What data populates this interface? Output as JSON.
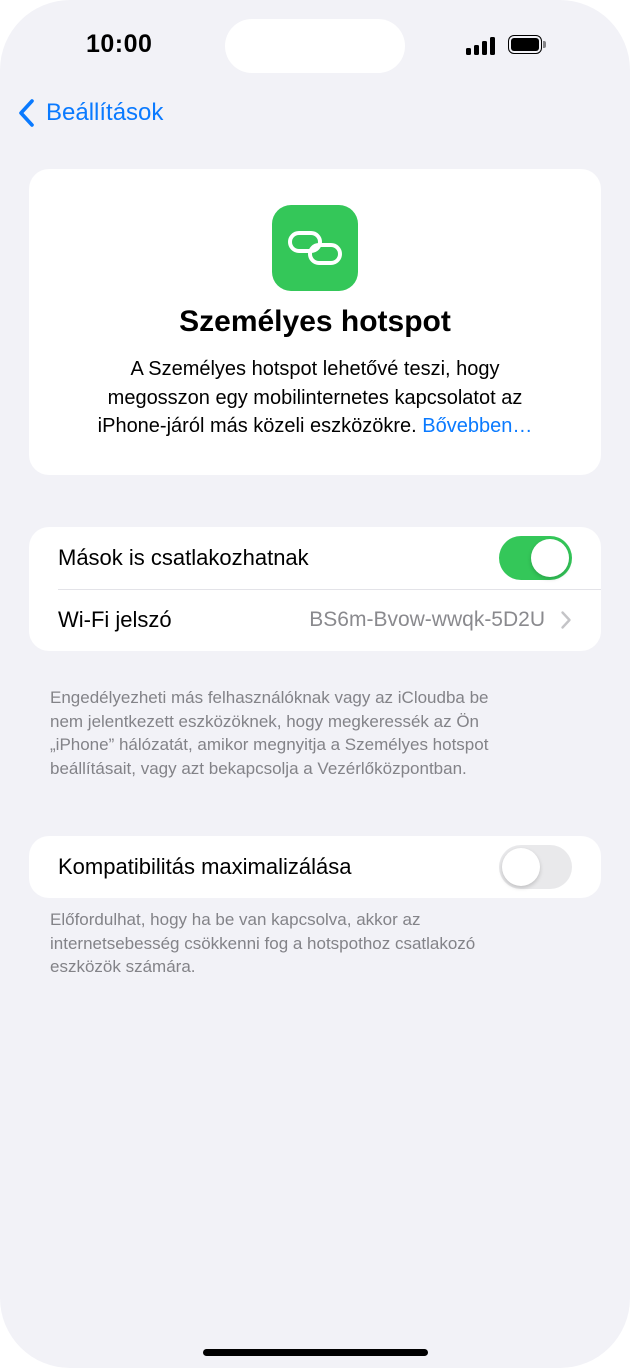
{
  "status_bar": {
    "time": "10:00"
  },
  "nav": {
    "back_label": "Beállítások"
  },
  "hero": {
    "icon": "link-icon",
    "title": "Személyes hotspot",
    "description_line1": "A Személyes hotspot lehetővé teszi, hogy",
    "description_line2": "megosszon egy mobilinternetes kapcsolatot az",
    "description_line3": "iPhone-járól más közeli eszközökre.",
    "learn_more": "Bővebben…"
  },
  "settings": {
    "allow_others": {
      "label": "Mások is csatlakozhatnak",
      "enabled": true
    },
    "wifi_password": {
      "label": "Wi-Fi jelszó",
      "value": "BS6m-Bvow-wwqk-5D2U"
    },
    "allow_footnote": {
      "line1": "Engedélyezheti más felhasználóknak vagy az iCloudba be",
      "line2": "nem jelentkezett eszközöknek, hogy megkeressék az Ön",
      "line3": "„iPhone” hálózatát, amikor megnyitja a Személyes hotspot",
      "line4": "beállításait, vagy azt bekapcsolja a Vezérlőközpontban."
    },
    "max_compat": {
      "label": "Kompatibilitás maximalizálása",
      "enabled": false
    },
    "compat_footnote": {
      "line1": "Előfordulhat, hogy ha be van kapcsolva, akkor az",
      "line2": "internetsebesség csökkenni fog a hotspothoz csatlakozó",
      "line3": "eszközök számára."
    }
  },
  "colors": {
    "accent": "#0a7aff",
    "toggle_on": "#34c759",
    "background": "#f2f2f7"
  }
}
